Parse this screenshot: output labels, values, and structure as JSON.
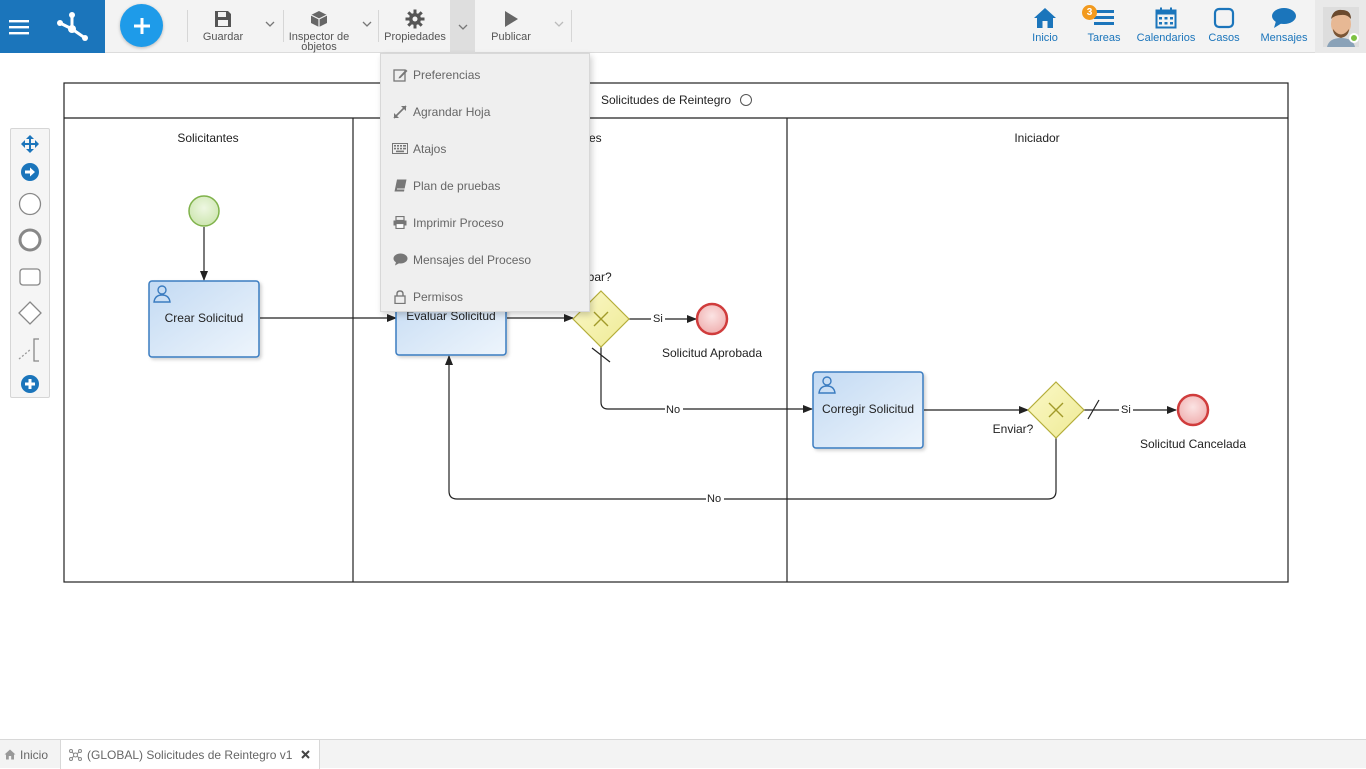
{
  "toolbar": {
    "save_label": "Guardar",
    "inspector_label_1": "Inspector de",
    "inspector_label_2": "objetos",
    "properties_label": "Propiedades",
    "publish_label": "Publicar"
  },
  "nav": {
    "home_label": "Inicio",
    "tasks_label": "Tareas",
    "tasks_badge": "3",
    "calendars_label": "Calendarios",
    "cases_label": "Casos",
    "messages_label": "Mensajes"
  },
  "properties_menu": [
    {
      "label": "Preferencias",
      "icon": "edit-icon"
    },
    {
      "label": "Agrandar Hoja",
      "icon": "expand-icon"
    },
    {
      "label": "Atajos",
      "icon": "keyboard-icon"
    },
    {
      "label": "Plan de pruebas",
      "icon": "book-icon"
    },
    {
      "label": "Imprimir Proceso",
      "icon": "print-icon"
    },
    {
      "label": "Mensajes del Proceso",
      "icon": "comment-icon"
    },
    {
      "label": "Permisos",
      "icon": "lock-icon"
    }
  ],
  "palette": [
    "move-icon",
    "connector-arrow-icon",
    "start-event-icon",
    "end-event-icon",
    "task-icon",
    "gateway-icon",
    "annotation-icon",
    "add-icon"
  ],
  "diagram": {
    "pool_title": "Solicitudes de Reintegro",
    "lanes": [
      "Solicitantes",
      "es",
      "Iniciador"
    ],
    "tasks": {
      "create": "Crear Solicitud",
      "evaluate": "Evaluar Solicitud",
      "correct": "Corregir Solicitud"
    },
    "gateways": {
      "approve": "robar?",
      "send": "Enviar?"
    },
    "events": {
      "approved": "Solicitud Aprobada",
      "cancelled": "Solicitud Cancelada"
    },
    "flow_labels": {
      "si_1": "Si",
      "no_1": "No",
      "si_2": "Si",
      "no_2": "No"
    }
  },
  "bottom_tabs": {
    "home_label": "Inicio",
    "process_label": "(GLOBAL) Solicitudes de Reintegro v1"
  },
  "colors": {
    "brand_blue": "#1b75bb",
    "add_button": "#1e9be9",
    "task_fill": "#d6e6f6",
    "task_stroke": "#3b7cc0",
    "gateway_fill": "#f6f3b0",
    "start_fill": "#d9edc0",
    "end_fill": "#f3c4c4",
    "badge": "#f29a1e"
  }
}
